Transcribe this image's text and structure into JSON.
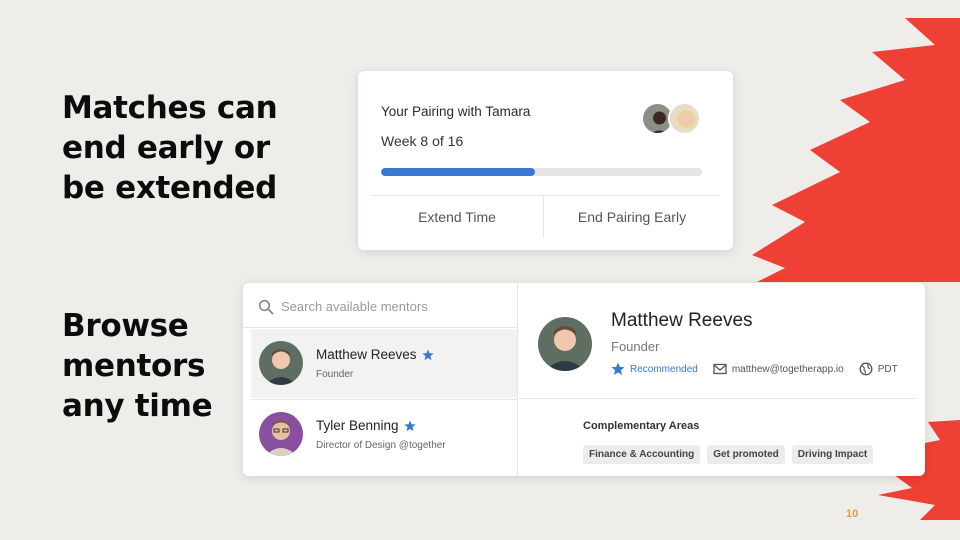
{
  "slide": {
    "heading_1": "Matches can\nend early or\nbe extended",
    "heading_2": "Browse\nmentors\nany time",
    "page_number": "10",
    "accent_color": "#ef4035"
  },
  "pairing": {
    "title": "Your Pairing with Tamara",
    "week": "Week 8 of 16",
    "progress": 0.48,
    "extend_label": "Extend Time",
    "end_label": "End Pairing Early"
  },
  "search": {
    "placeholder": "Search available mentors"
  },
  "mentors": [
    {
      "name": "Matthew Reeves",
      "subtitle": "Founder",
      "starred": true,
      "selected": true
    },
    {
      "name": "Tyler Benning",
      "subtitle": "Director of Design @together",
      "starred": true,
      "selected": false
    }
  ],
  "detail": {
    "name": "Matthew Reeves",
    "role": "Founder",
    "recommended": "Recommended",
    "email": "matthew@togetherapp.io",
    "timezone": "PDT",
    "areas_title": "Complementary Areas",
    "tags": [
      "Finance & Accounting",
      "Get promoted",
      "Driving Impact"
    ]
  },
  "colors": {
    "progress": "#3b78d2",
    "star": "#3b78d2"
  }
}
